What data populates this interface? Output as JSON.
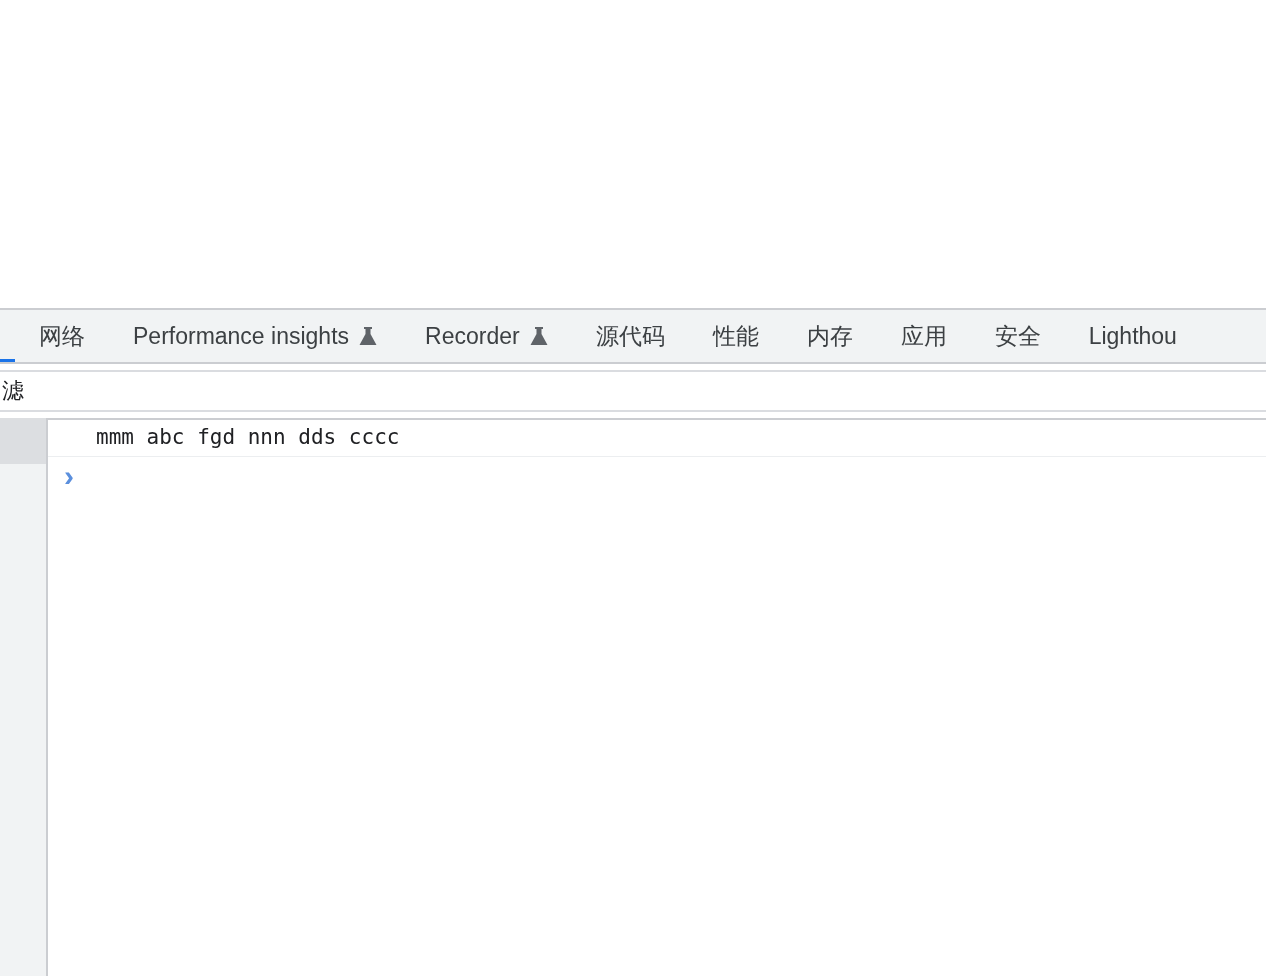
{
  "tabs": [
    {
      "selected": true
    },
    {
      "label": "网络",
      "selected": false
    },
    {
      "label": "Performance insights",
      "selected": false,
      "experimental": true
    },
    {
      "label": "Recorder",
      "selected": false,
      "experimental": true
    },
    {
      "label": "源代码",
      "selected": false
    },
    {
      "label": "性能",
      "selected": false
    },
    {
      "label": "内存",
      "selected": false
    },
    {
      "label": "应用",
      "selected": false
    },
    {
      "label": "安全",
      "selected": false
    },
    {
      "label": "Lighthou",
      "selected": false
    }
  ],
  "filter": {
    "placeholder": "滤"
  },
  "sidebar": {
    "items": [
      {
        "selected": true
      }
    ]
  },
  "console": {
    "messages": [
      "mmm abc fgd nnn dds cccc"
    ],
    "prompt": "›"
  }
}
